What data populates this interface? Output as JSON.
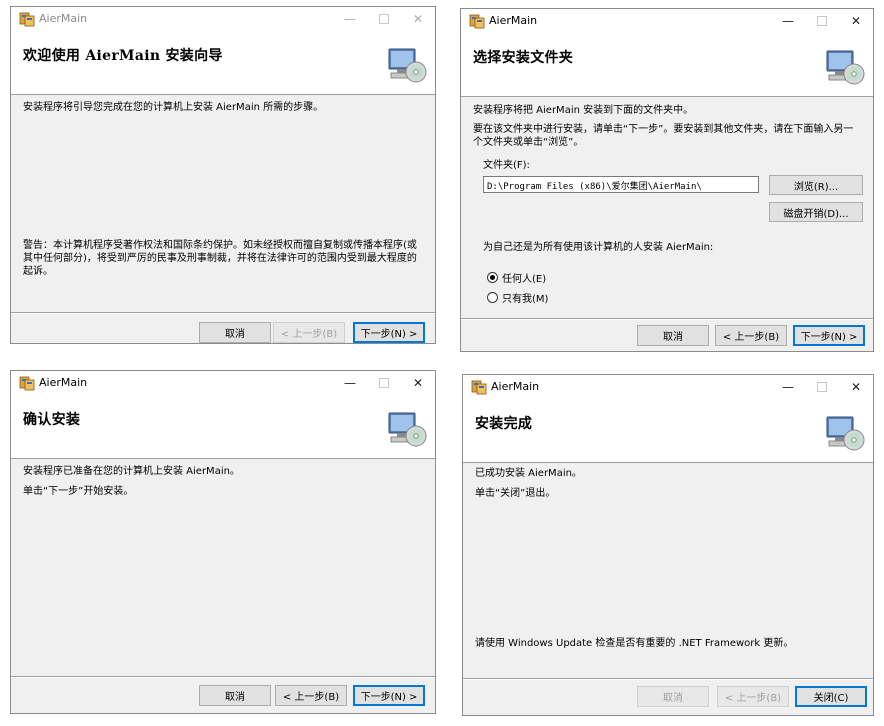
{
  "app_title": "AierMain",
  "window_controls": {
    "minimize": "—",
    "maximize": "□",
    "close": "✕"
  },
  "welcome": {
    "heading": "欢迎使用 AierMain 安装向导",
    "intro": "安装程序将引导您完成在您的计算机上安装 AierMain 所需的步骤。",
    "warning": "警告：本计算机程序受著作权法和国际条约保护。如未经授权而擅自复制或传播本程序(或其中任何部分)，将受到严厉的民事及刑事制裁，并将在法律许可的范围内受到最大程度的起诉。",
    "buttons": {
      "cancel": "取消",
      "back": "< 上一步(B)",
      "next": "下一步(N) >"
    }
  },
  "folder": {
    "heading": "选择安装文件夹",
    "line1": "安装程序将把 AierMain 安装到下面的文件夹中。",
    "line2": "要在该文件夹中进行安装，请单击“下一步”。要安装到其他文件夹，请在下面输入另一个文件夹或单击“浏览”。",
    "folder_label": "文件夹(F):",
    "folder_value": "D:\\Program Files (x86)\\爱尔集团\\AierMain\\",
    "browse": "浏览(R)...",
    "disk_cost": "磁盘开销(D)...",
    "install_for": "为自己还是为所有使用该计算机的人安装 AierMain:",
    "opt_everyone": "任何人(E)",
    "opt_just_me": "只有我(M)",
    "selected_option": "everyone",
    "buttons": {
      "cancel": "取消",
      "back": "< 上一步(B)",
      "next": "下一步(N) >"
    }
  },
  "confirm": {
    "heading": "确认安装",
    "line1": "安装程序已准备在您的计算机上安装 AierMain。",
    "line2": "单击“下一步”开始安装。",
    "buttons": {
      "cancel": "取消",
      "back": "< 上一步(B)",
      "next": "下一步(N) >"
    }
  },
  "complete": {
    "heading": "安装完成",
    "line1": "已成功安装 AierMain。",
    "line2": "单击“关闭”退出。",
    "note": "请使用 Windows Update 检查是否有重要的 .NET Framework 更新。",
    "buttons": {
      "cancel": "取消",
      "back": "< 上一步(B)",
      "close": "关闭(C)"
    }
  }
}
